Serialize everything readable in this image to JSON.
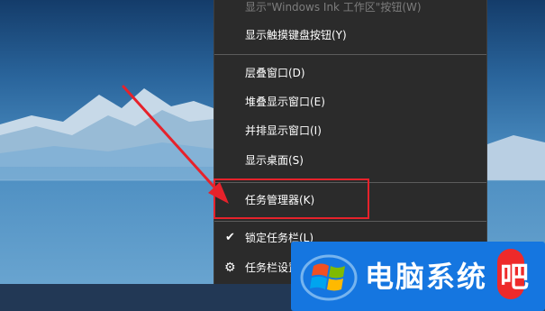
{
  "context_menu": {
    "items": [
      {
        "label": "显示\"Windows Ink 工作区\"按钮(W)",
        "enabled": false
      },
      {
        "label": "显示触摸键盘按钮(Y)",
        "enabled": true
      },
      {
        "label": "层叠窗口(D)",
        "enabled": true
      },
      {
        "label": "堆叠显示窗口(E)",
        "enabled": true
      },
      {
        "label": "并排显示窗口(I)",
        "enabled": true
      },
      {
        "label": "显示桌面(S)",
        "enabled": true
      },
      {
        "label": "任务管理器(K)",
        "enabled": true,
        "highlighted": true
      },
      {
        "label": "锁定任务栏(L)",
        "enabled": true,
        "checked": true
      },
      {
        "label": "任务栏设置",
        "enabled": true,
        "icon": "gear-icon"
      }
    ]
  },
  "watermark": {
    "text": "电脑系统",
    "text_last": "吧"
  },
  "colors": {
    "menu_bg": "#2b2b2b",
    "highlight_border": "#e6222b",
    "arrow": "#e6222b",
    "watermark_bg": "#1576e0"
  }
}
